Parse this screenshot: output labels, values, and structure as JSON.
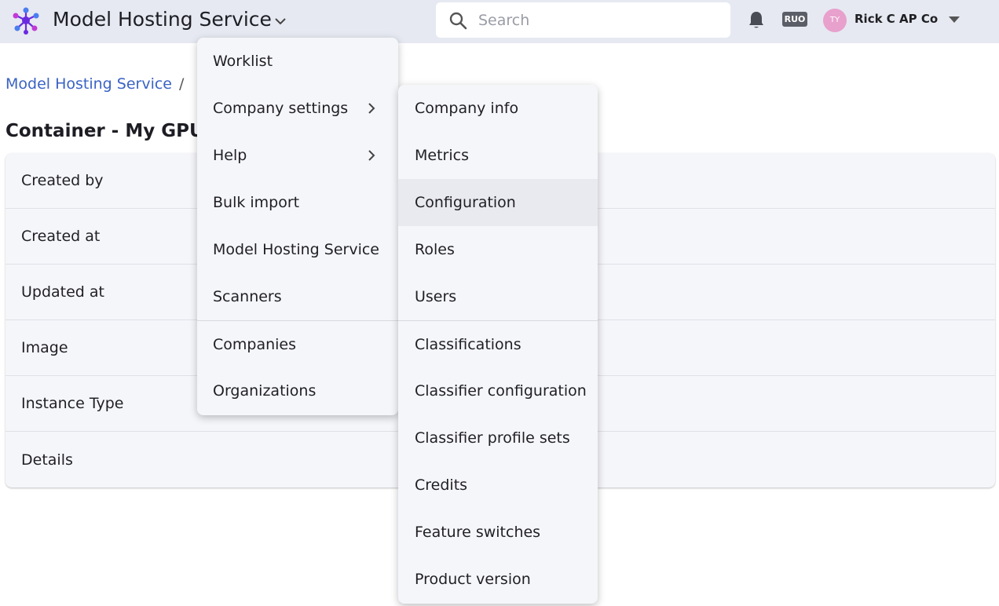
{
  "header": {
    "app_title": "Model Hosting Service",
    "search_placeholder": "Search",
    "badge": "RUO",
    "avatar_initials": "TY",
    "user_name": "Rick C AP Co"
  },
  "breadcrumb": {
    "root": "Model Hosting Service",
    "separator": "/"
  },
  "page_title": "Container - My GPU",
  "details": {
    "rows": [
      "Created by",
      "Created at",
      "Updated at",
      "Image",
      "Instance Type",
      "Details"
    ]
  },
  "menu": {
    "items": [
      "Worklist",
      "Company settings",
      "Help",
      "Bulk import",
      "Model Hosting Service",
      "Scanners",
      "Companies",
      "Organizations"
    ]
  },
  "submenu": {
    "items": [
      "Company info",
      "Metrics",
      "Configuration",
      "Roles",
      "Users",
      "Classifications",
      "Classifier configuration",
      "Classifier profile sets",
      "Credits",
      "Feature switches",
      "Product version"
    ],
    "highlighted": "Configuration"
  },
  "colors": {
    "topbar": "#e6e9f1",
    "link": "#3a63c4",
    "logo": "#6a2ae0",
    "avatar": "#e8a0cd"
  }
}
